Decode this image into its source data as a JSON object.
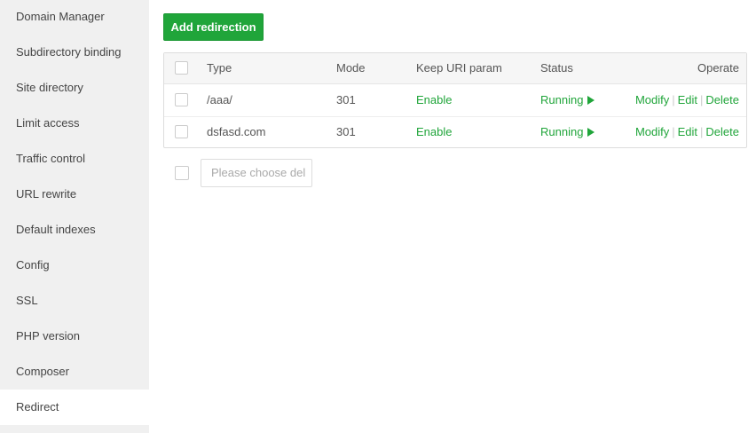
{
  "sidebar": {
    "items": [
      {
        "label": "Domain Manager"
      },
      {
        "label": "Subdirectory binding"
      },
      {
        "label": "Site directory"
      },
      {
        "label": "Limit access"
      },
      {
        "label": "Traffic control"
      },
      {
        "label": "URL rewrite"
      },
      {
        "label": "Default indexes"
      },
      {
        "label": "Config"
      },
      {
        "label": "SSL"
      },
      {
        "label": "PHP version"
      },
      {
        "label": "Composer"
      },
      {
        "label": "Redirect"
      }
    ],
    "active": "Redirect"
  },
  "toolbar": {
    "add_label": "Add redirection"
  },
  "table": {
    "columns": [
      "Type",
      "Mode",
      "Keep URI param",
      "Status",
      "Operate"
    ],
    "rows": [
      {
        "type": "/aaa/",
        "mode": "301",
        "keep": "Enable",
        "status": "Running",
        "ops": [
          "Modify",
          "Edit",
          "Delete"
        ]
      },
      {
        "type": "dsfasd.com",
        "mode": "301",
        "keep": "Enable",
        "status": "Running",
        "ops": [
          "Modify",
          "Edit",
          "Delete"
        ]
      }
    ]
  },
  "bulk": {
    "placeholder": "Please choose del"
  },
  "colors": {
    "accent": "#20a53a",
    "sidebar_bg": "#f0f0f0"
  },
  "icons": {
    "status_running": "play-icon"
  }
}
